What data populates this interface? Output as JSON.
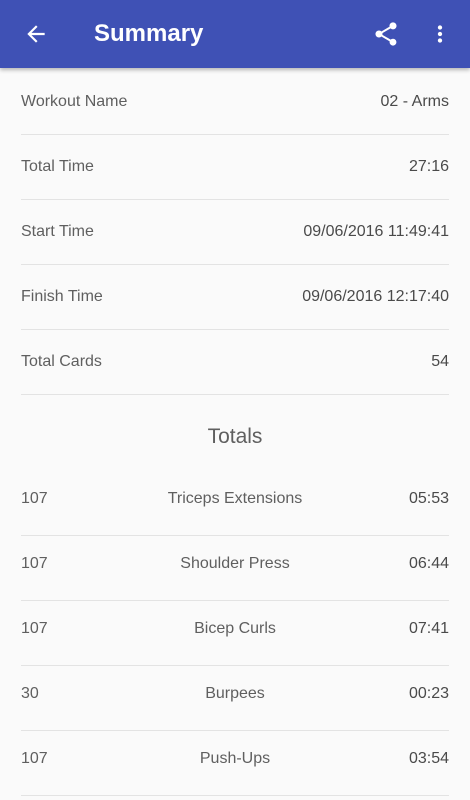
{
  "app_bar": {
    "title": "Summary",
    "back_icon": "arrow-back-icon",
    "share_icon": "share-icon",
    "more_icon": "more-vert-icon",
    "color": "#3f51b5"
  },
  "details": [
    {
      "label": "Workout Name",
      "value": "02 - Arms"
    },
    {
      "label": "Total Time",
      "value": "27:16"
    },
    {
      "label": "Start Time",
      "value": "09/06/2016 11:49:41"
    },
    {
      "label": "Finish Time",
      "value": "09/06/2016 12:17:40"
    },
    {
      "label": "Total Cards",
      "value": "54"
    }
  ],
  "totals": {
    "title": "Totals",
    "rows": [
      {
        "count": "107",
        "exercise": "Triceps Extensions",
        "time": "05:53"
      },
      {
        "count": "107",
        "exercise": "Shoulder Press",
        "time": "06:44"
      },
      {
        "count": "107",
        "exercise": "Bicep Curls",
        "time": "07:41"
      },
      {
        "count": "30",
        "exercise": "Burpees",
        "time": "00:23"
      },
      {
        "count": "107",
        "exercise": "Push-Ups",
        "time": "03:54"
      }
    ]
  }
}
